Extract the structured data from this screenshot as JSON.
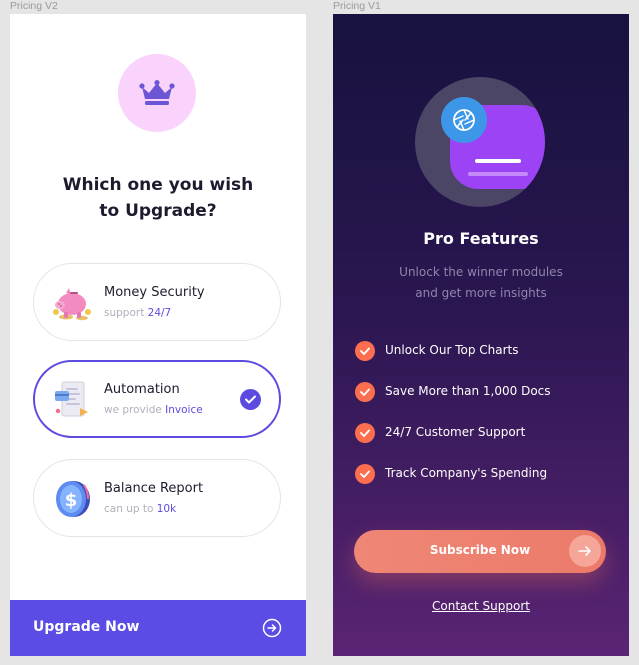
{
  "frames": {
    "v2_label": "Pricing V2",
    "v1_label": "Pricing V1"
  },
  "v2": {
    "title_line1": "Which one you wish",
    "title_line2": "to Upgrade?",
    "crown_icon": "crown-icon",
    "options": [
      {
        "title": "Money Security",
        "sub_prefix": "support ",
        "sub_highlight": "24/7",
        "icon": "piggy-bank-icon",
        "selected": false
      },
      {
        "title": "Automation",
        "sub_prefix": "we provide ",
        "sub_highlight": "Invoice",
        "icon": "invoice-icon",
        "selected": true
      },
      {
        "title": "Balance Report",
        "sub_prefix": "can up to ",
        "sub_highlight": "10k",
        "icon": "dollar-coin-icon",
        "selected": false
      }
    ],
    "upgrade_label": "Upgrade Now"
  },
  "v1": {
    "title": "Pro Features",
    "subtitle_line1": "Unlock the winner modules",
    "subtitle_line2": "and get more insights",
    "features": [
      "Unlock Our Top Charts",
      "Save More than 1,000 Docs",
      "24/7 Customer Support",
      "Track Company's Spending"
    ],
    "subscribe_label": "Subscribe Now",
    "contact_label": "Contact Support"
  },
  "colors": {
    "accent_purple": "#5a4ce4",
    "check_orange": "#fb6e50",
    "subscribe": "#ec7a69",
    "crown_bg": "#f9d3fb",
    "v1_bg_top": "#17123f",
    "v1_bg_bottom": "#5a2474"
  }
}
